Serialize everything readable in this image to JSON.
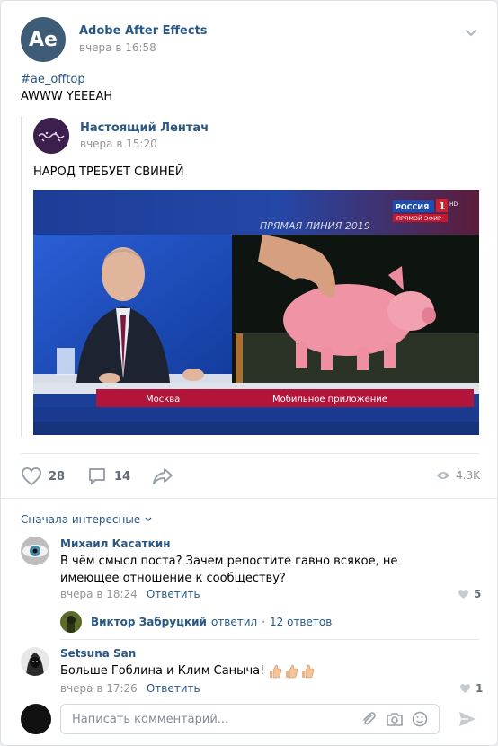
{
  "post": {
    "avatar_text": "Ae",
    "author": "Adobe After Effects",
    "time": "вчера в 16:58",
    "hashtag": "#ae_offtop",
    "text": "AWWW YEEEAH"
  },
  "repost": {
    "author": "Настоящий Лентач",
    "time": "вчера в 15:20",
    "text": "НАРОД ТРЕБУЕТ СВИНЕЙ",
    "image": {
      "channel_banner": "ПРЯМАЯ ЛИНИЯ 2019",
      "channel_logo": "РОССИЯ",
      "channel_number": "1",
      "channel_hd": "HD",
      "live_label": "ПРЯМОЙ ЭФИР",
      "caption_left": "Москва",
      "caption_right": "Мобильное приложение"
    }
  },
  "actions": {
    "likes": "28",
    "comments": "14",
    "views": "4.3K"
  },
  "comments_sort": "Сначала интересные",
  "comments": [
    {
      "author": "Михаил Касаткин",
      "text": "В чём смысл поста? Зачем репостите гавно всякое, не имеющее отношение к сообществу?",
      "time": "вчера в 18:24",
      "reply": "Ответить",
      "likes": "5"
    },
    {
      "author": "Setsuna San",
      "text": "Больше Гоблина и Клим Саныча!",
      "emoji": "👍🏼👍🏼👍🏼",
      "time": "вчера в 17:26",
      "reply": "Ответить",
      "likes": "1"
    }
  ],
  "thread": {
    "author": "Виктор Забруцкий",
    "action": "ответил",
    "count": "12 ответов"
  },
  "composer": {
    "placeholder": "Написать комментарий..."
  }
}
